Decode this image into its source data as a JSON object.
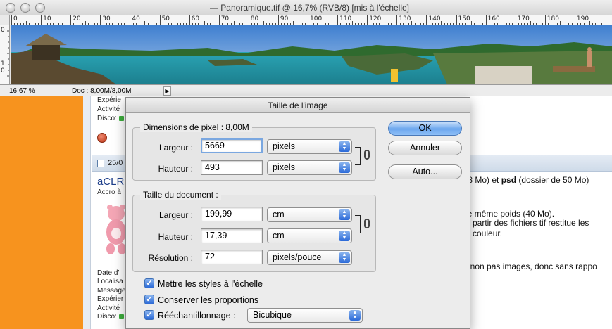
{
  "window": {
    "title": "— Panoramique.tif @ 16,7% (RVB/8) [mis à l'échelle]"
  },
  "rulers": {
    "top_labels": [
      "0",
      "10",
      "20",
      "30",
      "40",
      "50",
      "60",
      "70",
      "80",
      "90",
      "100",
      "110",
      "120",
      "130",
      "140",
      "150",
      "160",
      "170",
      "180",
      "190"
    ],
    "left_labels": [
      "0",
      "1",
      "0"
    ]
  },
  "statusbar": {
    "zoom": "16,67 %",
    "doc_info": "Doc : 8,00M/8,00M"
  },
  "background_page": {
    "meta_top": [
      "Expérie",
      "Activité",
      "Disco:"
    ],
    "post_date": "25/0",
    "author_name": "aCLR",
    "author_sub": "Accro à",
    "meta_bottom": [
      "Date d'i",
      "Localisa",
      "Message",
      "Expérier",
      "Activité",
      "Disco:"
    ],
    "right_lines": [
      {
        "before": ",8 Mo) et ",
        "bold": "psd",
        "after": " (dossier de 50 Mo)"
      },
      {
        "before": "le même poids (40 Mo).",
        "bold": "",
        "after": ""
      },
      {
        "before": "à partir des fichiers tif restitue les",
        "bold": "",
        "after": ""
      },
      {
        "before": "e couleur.",
        "bold": "",
        "after": ""
      },
      {
        "before": "t non pas images, donc sans rappo",
        "bold": "",
        "after": ""
      }
    ]
  },
  "dialog": {
    "title": "Taille de l'image",
    "pixel_dimensions": {
      "legend": "Dimensions de pixel :  8,00M",
      "width_label": "Largeur :",
      "width_value": "5669",
      "width_unit": "pixels",
      "height_label": "Hauteur :",
      "height_value": "493",
      "height_unit": "pixels"
    },
    "document_size": {
      "legend": "Taille du document :",
      "width_label": "Largeur :",
      "width_value": "199,99",
      "width_unit": "cm",
      "height_label": "Hauteur :",
      "height_value": "17,39",
      "height_unit": "cm",
      "resolution_label": "Résolution :",
      "resolution_value": "72",
      "resolution_unit": "pixels/pouce"
    },
    "options": {
      "scale_styles": "Mettre les styles à l'échelle",
      "constrain": "Conserver les proportions",
      "resample": "Rééchantillonnage :",
      "resample_method": "Bicubique"
    },
    "buttons": {
      "ok": "OK",
      "cancel": "Annuler",
      "auto": "Auto..."
    }
  }
}
